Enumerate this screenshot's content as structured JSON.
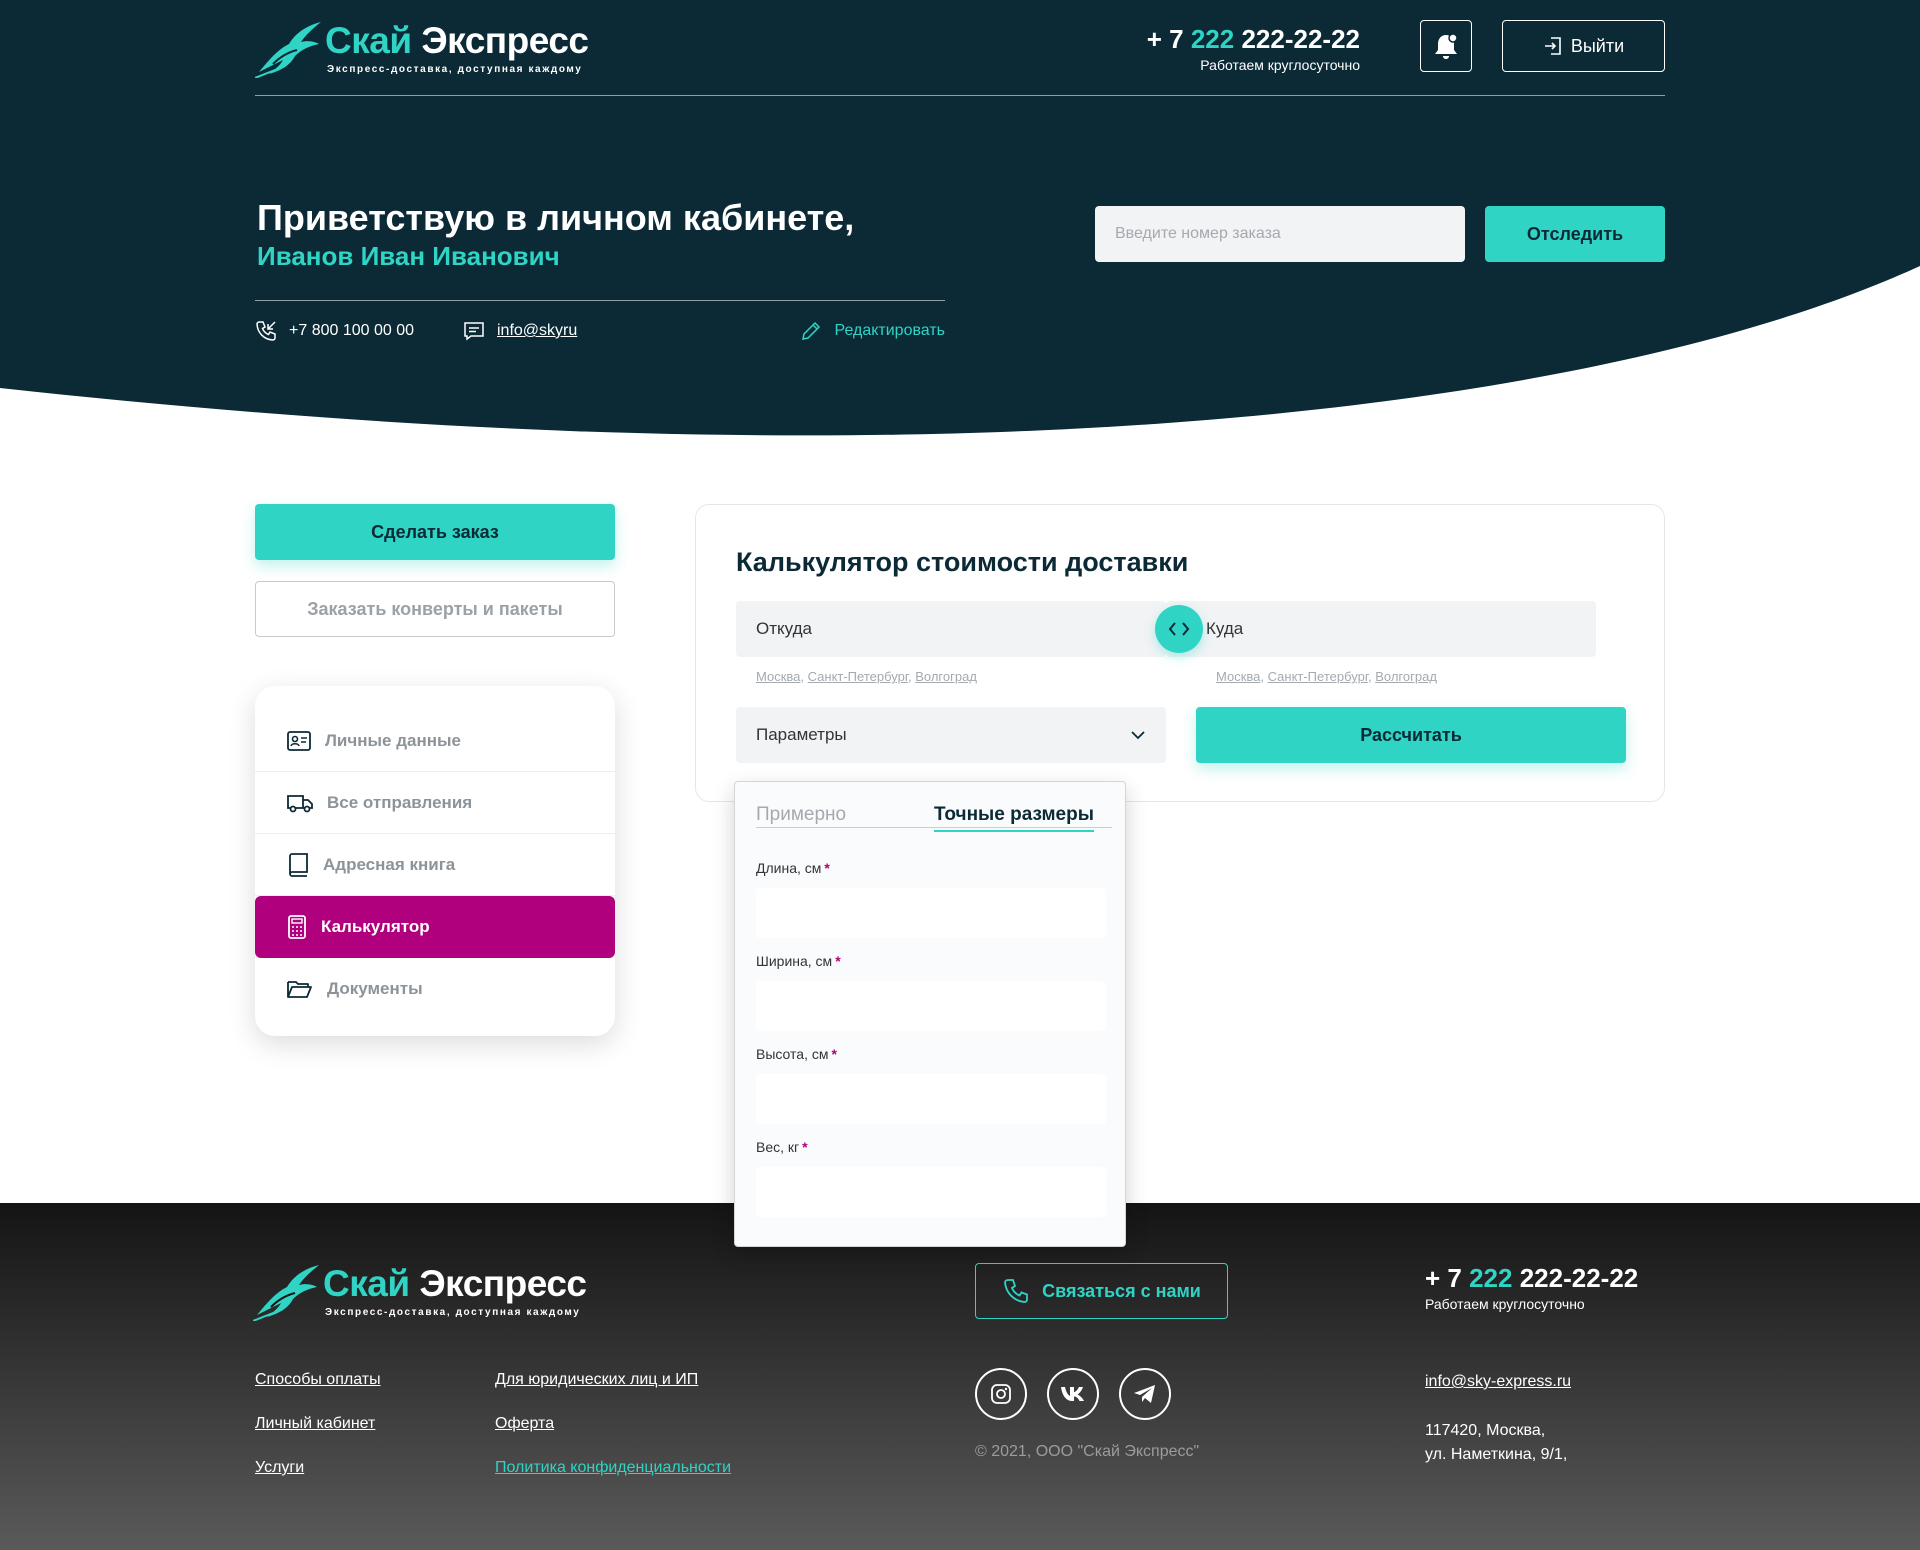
{
  "header": {
    "logo_name_part1": "Скай",
    "logo_name_part2": "Экспресс",
    "logo_tagline": "Экспресс-доставка, доступная каждому",
    "phone_prefix": "+ 7 ",
    "phone_code": "222",
    "phone_number": " 222-22-22",
    "phone_note": "Работаем круглосуточно",
    "logout_label": "Выйти"
  },
  "hero": {
    "greeting": "Приветствую в личном кабинете,",
    "user_name": "Иванов Иван Иванович",
    "phone": "+7 800 100 00 00",
    "email": "info@skyru",
    "edit_label": "Редактировать",
    "track_placeholder": "Введите номер заказа",
    "track_button": "Отследить"
  },
  "sidebar": {
    "order_button": "Сделать заказ",
    "envelopes_button": "Заказать конверты и пакеты",
    "items": [
      {
        "label": "Личные данные",
        "icon": "id-card-icon",
        "active": false
      },
      {
        "label": "Все отправления",
        "icon": "truck-icon",
        "active": false
      },
      {
        "label": "Адресная книга",
        "icon": "book-icon",
        "active": false
      },
      {
        "label": "Калькулятор",
        "icon": "calculator-icon",
        "active": true
      },
      {
        "label": "Документы",
        "icon": "folder-icon",
        "active": false
      }
    ]
  },
  "calculator": {
    "title": "Калькулятор стоимости доставки",
    "from_placeholder": "Откуда",
    "to_placeholder": "Куда",
    "city_hints": [
      "Москва",
      "Санкт-Петербург",
      "Волгоград"
    ],
    "params_label": "Параметры",
    "calc_button": "Рассчитать",
    "panel": {
      "tab_approx": "Примерно",
      "tab_exact": "Точные размеры",
      "length_label": "Длина, см",
      "width_label": "Ширина, см",
      "height_label": "Высота, см",
      "weight_label": "Вес, кг",
      "required_mark": "*"
    }
  },
  "footer": {
    "links_col1": [
      "Способы оплаты",
      "Личный кабинет",
      "Услуги"
    ],
    "links_col2": [
      "Для юридических лиц и ИП",
      "Оферта",
      "Политика конфиденциальности"
    ],
    "contact_button": "Связаться с нами",
    "copyright": "© 2021, ООО \"Скай Экспресс\"",
    "email": "info@sky-express.ru",
    "address_line1": "117420, Москва,",
    "address_line2": "ул. Наметкина, 9/1,",
    "social": [
      "instagram-icon",
      "vk-icon",
      "telegram-icon"
    ]
  },
  "colors": {
    "dark": "#0b2a36",
    "accent": "#2fd4c5",
    "active_menu": "#b0007e"
  }
}
